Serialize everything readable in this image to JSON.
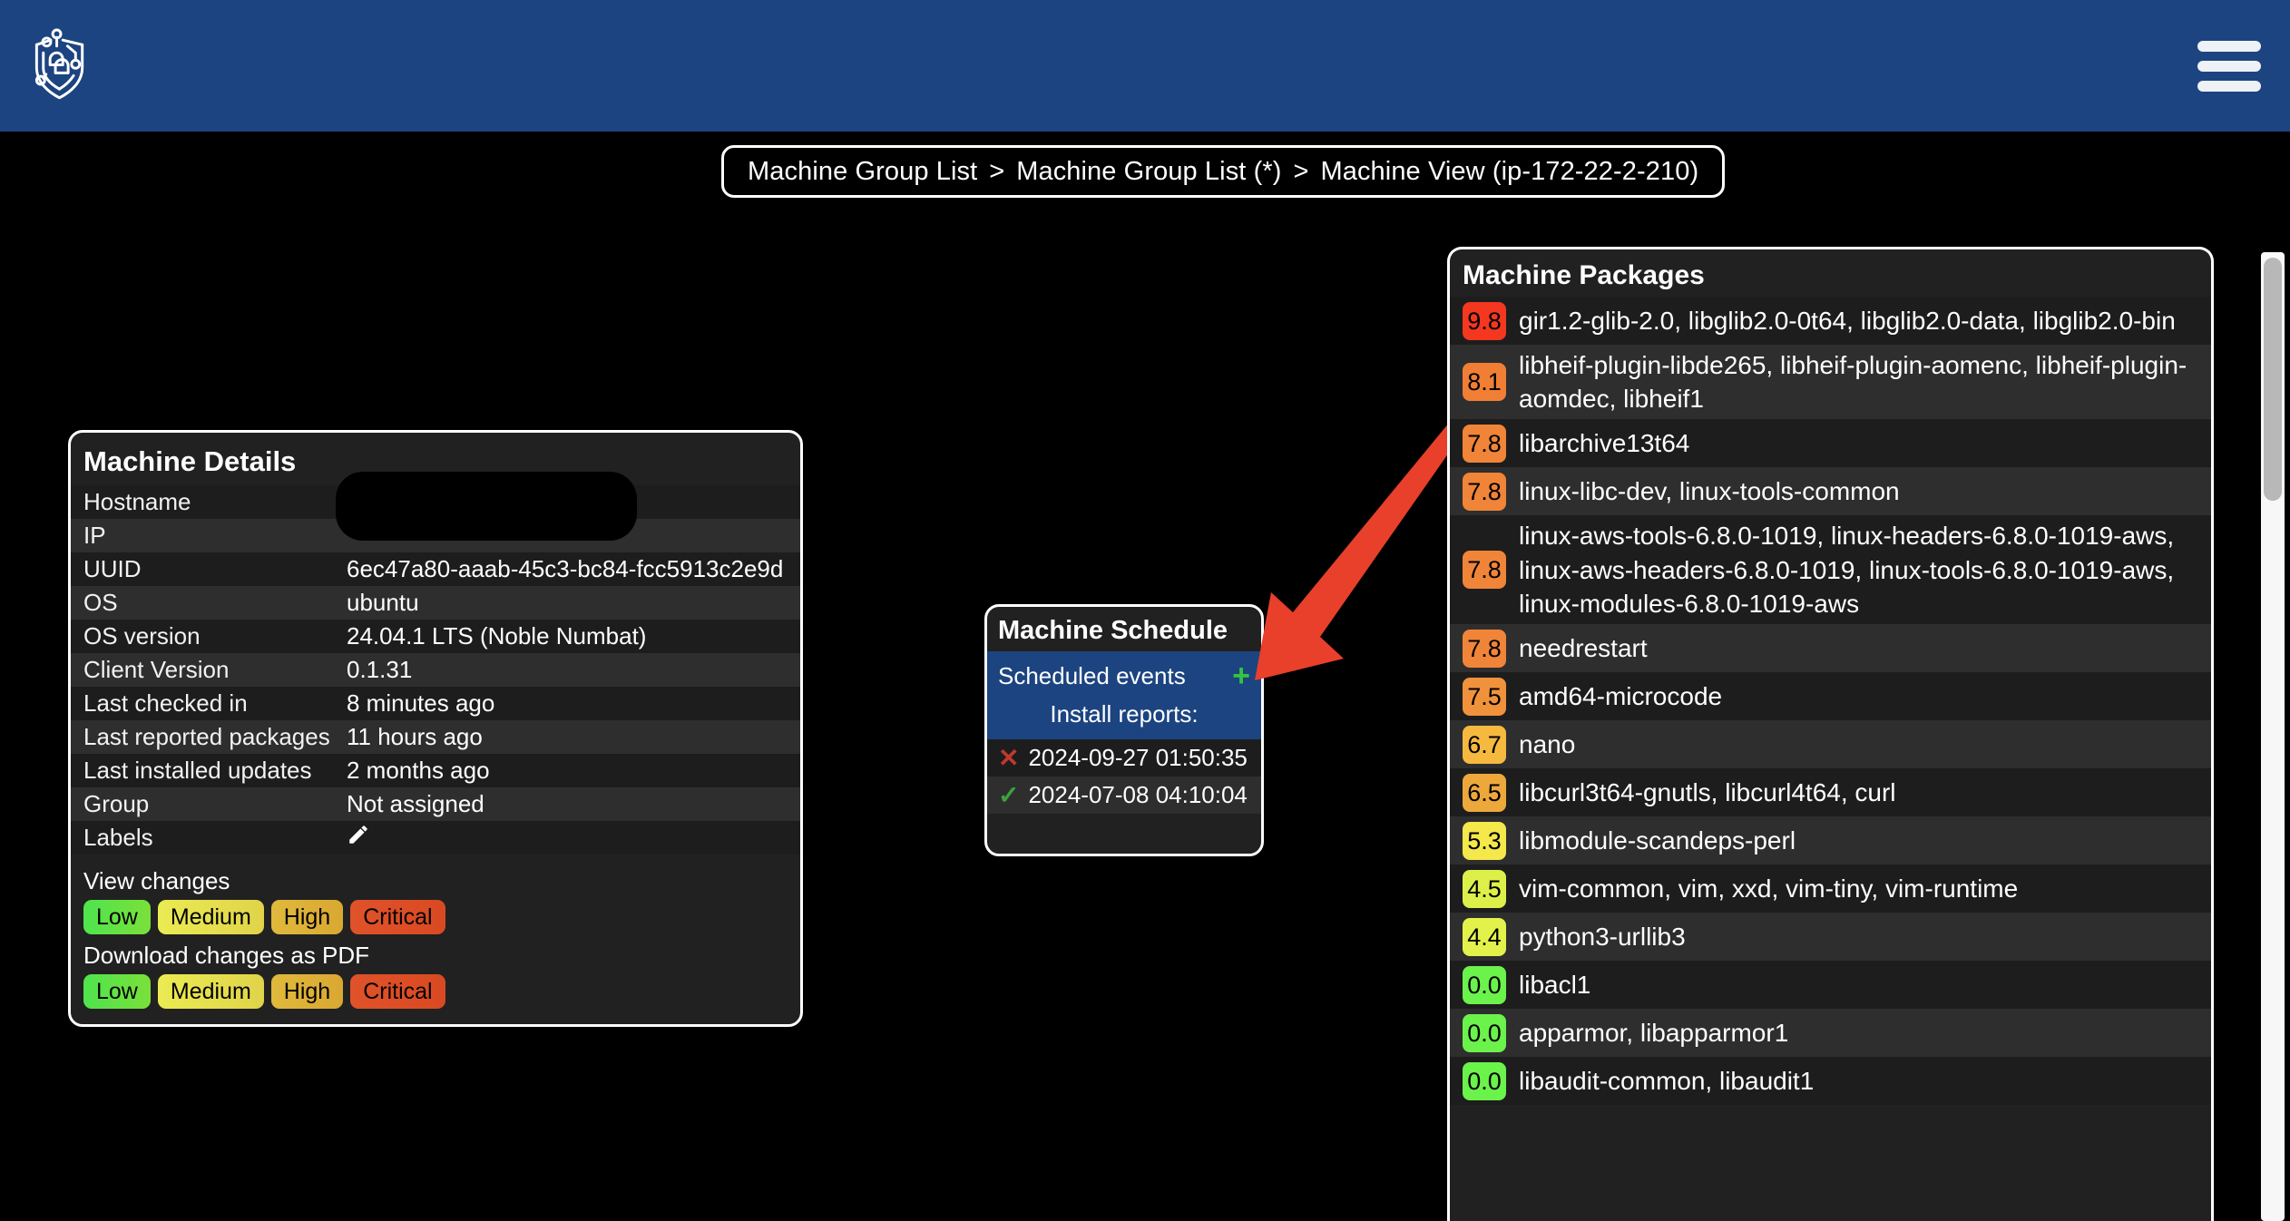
{
  "header": {
    "logo_name": "shield-network-logo",
    "menu_label": "menu"
  },
  "breadcrumb": {
    "items": [
      {
        "label": "Machine Group List"
      },
      {
        "label": "Machine Group List (*)"
      },
      {
        "label": "Machine View (ip-172-22-2-210)"
      }
    ],
    "separator": ">"
  },
  "machine_details": {
    "title": "Machine Details",
    "rows": [
      {
        "key": "Hostname",
        "value": ""
      },
      {
        "key": "IP",
        "value": ""
      },
      {
        "key": "UUID",
        "value": "6ec47a80-aaab-45c3-bc84-fcc5913c2e9d"
      },
      {
        "key": "OS",
        "value": "ubuntu"
      },
      {
        "key": "OS version",
        "value": "24.04.1 LTS (Noble Numbat)"
      },
      {
        "key": "Client Version",
        "value": "0.1.31"
      },
      {
        "key": "Last checked in",
        "value": "8 minutes ago"
      },
      {
        "key": "Last reported packages",
        "value": "11 hours ago"
      },
      {
        "key": "Last installed updates",
        "value": "2 months ago"
      },
      {
        "key": "Group",
        "value": "Not assigned"
      },
      {
        "key": "Labels",
        "value": ""
      }
    ],
    "labels_edit_icon": "pencil-icon",
    "view_changes_label": "View changes",
    "download_changes_label": "Download changes as PDF",
    "severity_buttons": [
      {
        "label": "Low",
        "color": "#4ee44e"
      },
      {
        "label": "Medium",
        "color": "#ebeb52"
      },
      {
        "label": "High",
        "color": "#e0b93c"
      },
      {
        "label": "Critical",
        "color": "#e0522a"
      }
    ]
  },
  "machine_schedule": {
    "title": "Machine Schedule",
    "scheduled_events_label": "Scheduled events",
    "add_icon": "plus-icon",
    "install_reports_label": "Install reports:",
    "reports": [
      {
        "status": "failed",
        "mark": "✕",
        "timestamp": "2024-09-27 01:50:35"
      },
      {
        "status": "success",
        "mark": "✓",
        "timestamp": "2024-07-08 04:10:04"
      }
    ],
    "header_color": "#1c4480"
  },
  "machine_packages": {
    "title": "Machine Packages",
    "rows": [
      {
        "score": "9.8",
        "color": "#f4371f",
        "packages": "gir1.2-glib-2.0, libglib2.0-0t64, libglib2.0-data, libglib2.0-bin"
      },
      {
        "score": "8.1",
        "color": "#f07f35",
        "packages": "libheif-plugin-libde265, libheif-plugin-aomenc, libheif-plugin-aomdec, libheif1"
      },
      {
        "score": "7.8",
        "color": "#f08438",
        "packages": "libarchive13t64"
      },
      {
        "score": "7.8",
        "color": "#f08438",
        "packages": "linux-libc-dev, linux-tools-common"
      },
      {
        "score": "7.8",
        "color": "#f08438",
        "packages": "linux-aws-tools-6.8.0-1019, linux-headers-6.8.0-1019-aws, linux-aws-headers-6.8.0-1019, linux-tools-6.8.0-1019-aws, linux-modules-6.8.0-1019-aws"
      },
      {
        "score": "7.8",
        "color": "#f08438",
        "packages": "needrestart"
      },
      {
        "score": "7.5",
        "color": "#f0923b",
        "packages": "amd64-microcode"
      },
      {
        "score": "6.7",
        "color": "#f5b940",
        "packages": "nano"
      },
      {
        "score": "6.5",
        "color": "#eda83c",
        "packages": "libcurl3t64-gnutls, libcurl4t64, curl"
      },
      {
        "score": "5.3",
        "color": "#f4e84a",
        "packages": "libmodule-scandeps-perl"
      },
      {
        "score": "4.5",
        "color": "#ddf04a",
        "packages": "vim-common, vim, xxd, vim-tiny, vim-runtime"
      },
      {
        "score": "4.4",
        "color": "#e3f24b",
        "packages": "python3-urllib3"
      },
      {
        "score": "0.0",
        "color": "#6bf24b",
        "packages": "libacl1"
      },
      {
        "score": "0.0",
        "color": "#6bf24b",
        "packages": "apparmor, libapparmor1"
      },
      {
        "score": "0.0",
        "color": "#6bf24b",
        "packages": "libaudit-common, libaudit1"
      }
    ],
    "scrollbar": {
      "name": "packages-scrollbar"
    }
  },
  "annotation": {
    "arrow_color": "#e8402a",
    "arrow_name": "red-pointer-arrow"
  }
}
